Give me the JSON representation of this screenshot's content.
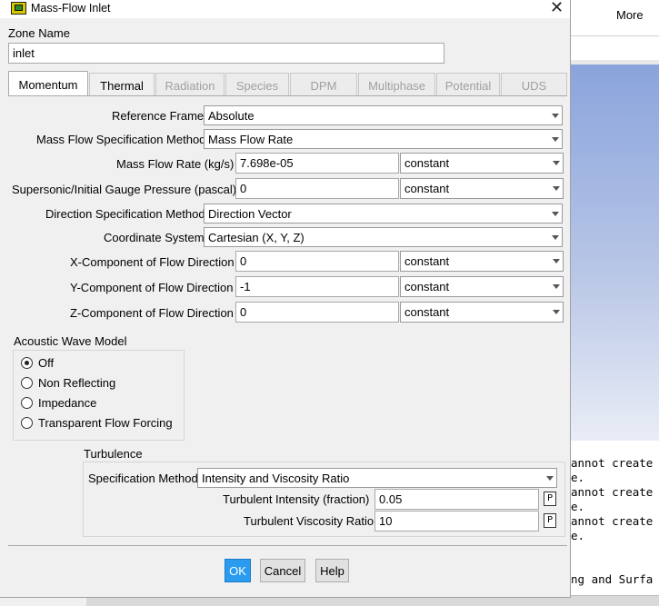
{
  "dialog": {
    "title": "Mass-Flow Inlet",
    "zone_name_label": "Zone Name",
    "zone_name_value": "inlet",
    "tabs": [
      {
        "label": "Momentum"
      },
      {
        "label": "Thermal"
      },
      {
        "label": "Radiation"
      },
      {
        "label": "Species"
      },
      {
        "label": "DPM"
      },
      {
        "label": "Multiphase"
      },
      {
        "label": "Potential"
      },
      {
        "label": "UDS"
      }
    ],
    "momentum": {
      "reference_frame": {
        "label": "Reference Frame",
        "value": "Absolute"
      },
      "mass_flow_spec": {
        "label": "Mass Flow Specification Method",
        "value": "Mass Flow Rate"
      },
      "mass_flow_rate": {
        "label": "Mass Flow Rate (kg/s)",
        "value": "7.698e-05",
        "profile": "constant"
      },
      "gauge_pressure": {
        "label": "Supersonic/Initial Gauge Pressure (pascal)",
        "value": "0",
        "profile": "constant"
      },
      "direction_spec": {
        "label": "Direction Specification Method",
        "value": "Direction Vector"
      },
      "coord_system": {
        "label": "Coordinate System",
        "value": "Cartesian (X, Y, Z)"
      },
      "x_component": {
        "label": "X-Component of Flow Direction",
        "value": "0",
        "profile": "constant"
      },
      "y_component": {
        "label": "Y-Component of Flow Direction",
        "value": "-1",
        "profile": "constant"
      },
      "z_component": {
        "label": "Z-Component of Flow Direction",
        "value": "0",
        "profile": "constant"
      }
    },
    "acoustic": {
      "title": "Acoustic Wave Model",
      "options": [
        "Off",
        "Non Reflecting",
        "Impedance",
        "Transparent Flow Forcing"
      ],
      "selected": "Off"
    },
    "turbulence": {
      "title": "Turbulence",
      "spec_method_label": "Specification Method",
      "spec_method_value": "Intensity and Viscosity Ratio",
      "intensity_label": "Turbulent Intensity (fraction)",
      "intensity_value": "0.05",
      "viscosity_label": "Turbulent Viscosity Ratio",
      "viscosity_value": "10",
      "p_button": "P"
    },
    "buttons": {
      "ok": "OK",
      "cancel": "Cancel",
      "help": "Help"
    }
  },
  "background": {
    "more_label": "More",
    "console_lines": [
      "annot create",
      "e.",
      "annot create",
      "e.",
      "annot create",
      "e.",
      "",
      "",
      "ng and Surfa"
    ]
  }
}
